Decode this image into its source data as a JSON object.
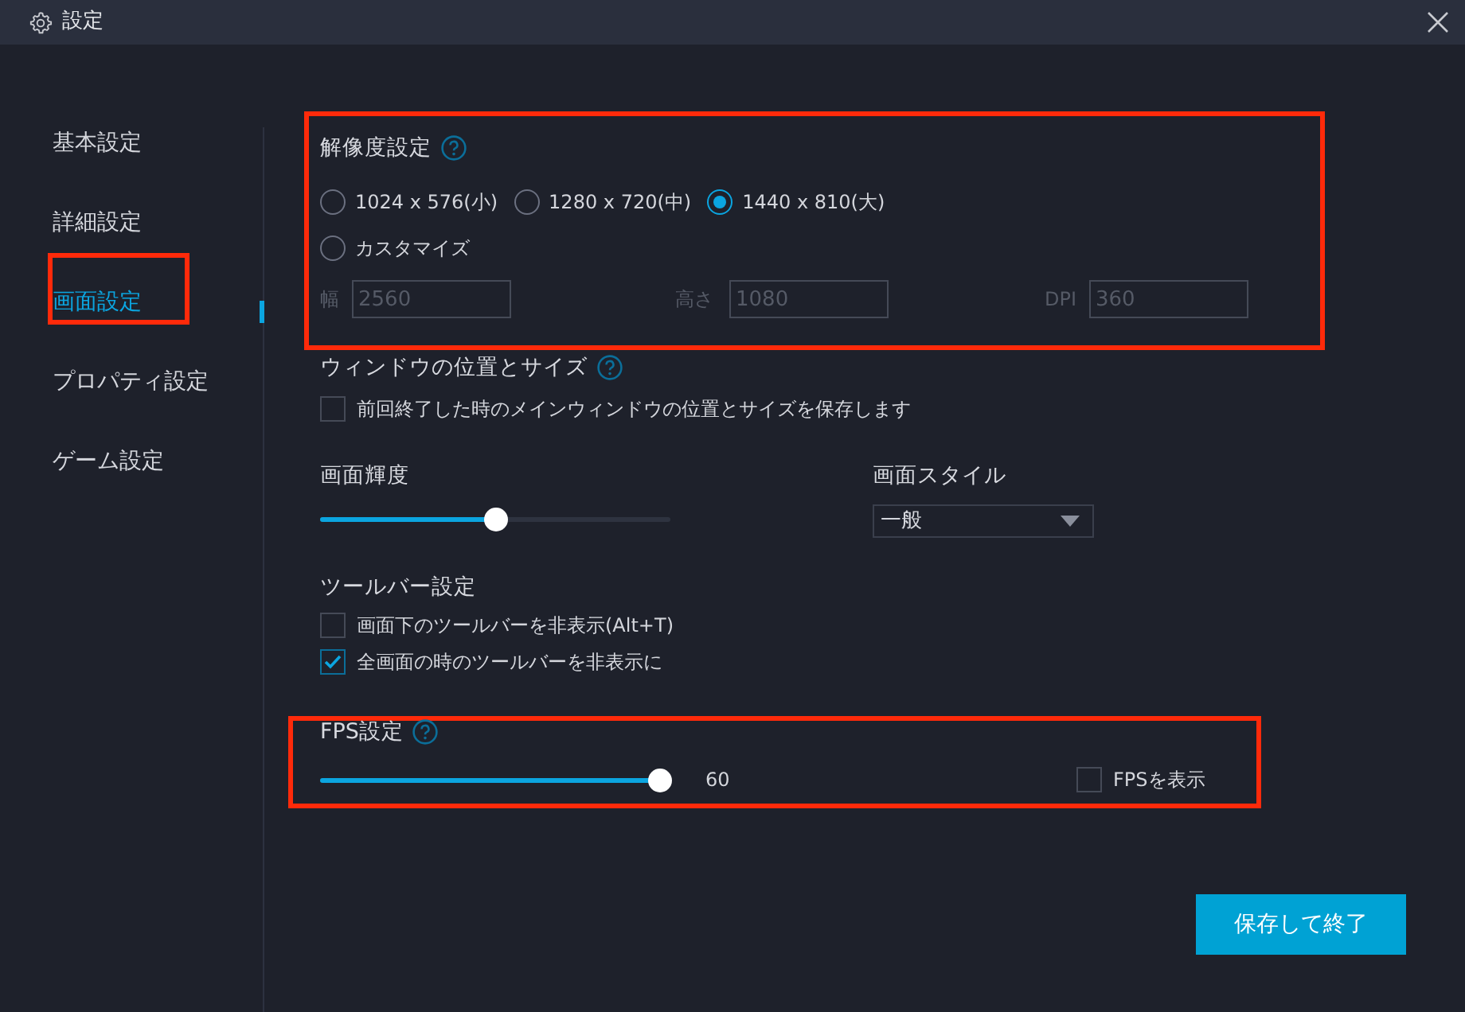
{
  "window": {
    "title": "設定"
  },
  "sidebar": {
    "items": [
      {
        "label": "基本設定",
        "selected": false,
        "highlighted": false
      },
      {
        "label": "詳細設定",
        "selected": false,
        "highlighted": false
      },
      {
        "label": "画面設定",
        "selected": true,
        "highlighted": true
      },
      {
        "label": "プロパティ設定",
        "selected": false,
        "highlighted": false
      },
      {
        "label": "ゲーム設定",
        "selected": false,
        "highlighted": false
      }
    ]
  },
  "resolution": {
    "title": "解像度設定",
    "highlighted": true,
    "options": [
      {
        "label": "1024 x 576(小)",
        "selected": false
      },
      {
        "label": "1280 x 720(中)",
        "selected": false
      },
      {
        "label": "1440 x 810(大)",
        "selected": true
      },
      {
        "label": "カスタマイズ",
        "selected": false
      }
    ],
    "fields": [
      {
        "label": "幅",
        "value": "2560",
        "disabled": true
      },
      {
        "label": "高さ",
        "value": "1080",
        "disabled": true
      },
      {
        "label": "DPI",
        "value": "360",
        "disabled": true
      }
    ]
  },
  "window_position": {
    "title": "ウィンドウの位置とサイズ",
    "checkbox": {
      "label": "前回終了した時のメインウィンドウの位置とサイズを保存します",
      "checked": false
    }
  },
  "brightness": {
    "title": "画面輝度",
    "level": 0.5
  },
  "screen_style": {
    "title": "画面スタイル",
    "value": "一般"
  },
  "toolbar": {
    "title": "ツールバー設定",
    "checkboxes": [
      {
        "label": "画面下のツールバーを非表示(Alt+T)",
        "checked": false
      },
      {
        "label": "全画面の時のツールバーを非表示に",
        "checked": true
      }
    ]
  },
  "fps": {
    "title": "FPS設定",
    "highlighted": true,
    "level": 1,
    "reading": "60",
    "checkbox": {
      "label": "FPSを表示",
      "checked": false
    }
  },
  "buttons": [
    {
      "label": "保存して終了"
    }
  ]
}
